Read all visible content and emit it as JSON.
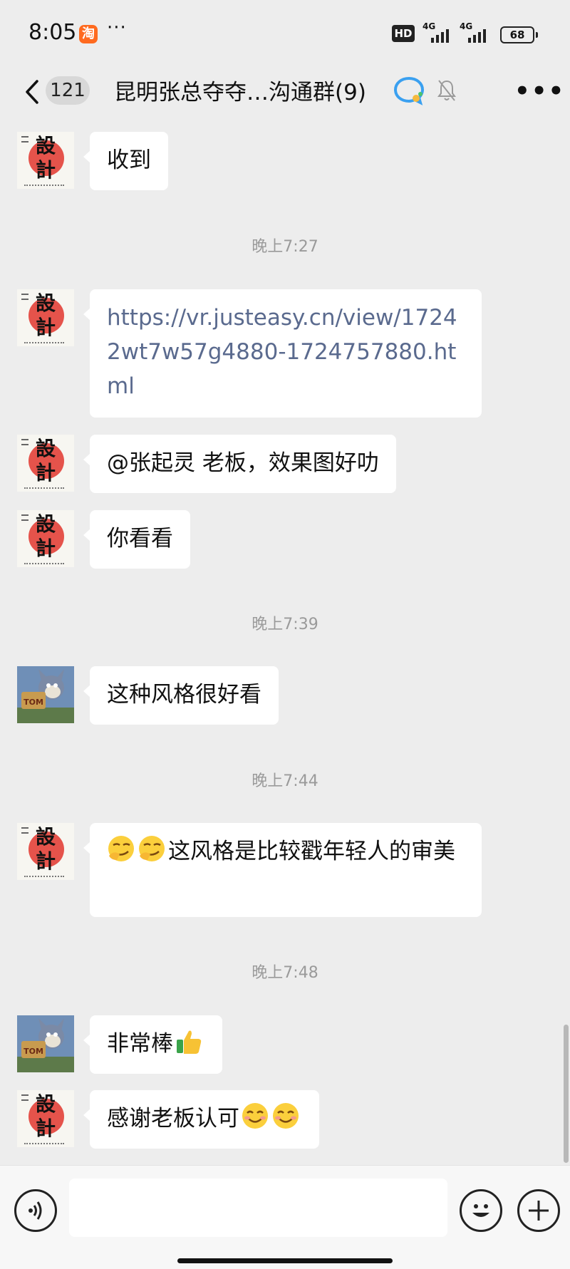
{
  "status_bar": {
    "time": "8:05",
    "app_badge": "淘",
    "more_notifications": "···",
    "hd_label": "HD",
    "network1": "4G",
    "network2": "4G",
    "battery": "68"
  },
  "header": {
    "unread_count": "121",
    "title": "昆明张总夺夺…沟通群(9)",
    "icons": [
      "back-icon",
      "ai-chat-icon",
      "mute-icon",
      "more-icon"
    ]
  },
  "messages": [
    {
      "type": "text",
      "sender": "design",
      "text": "收到"
    },
    {
      "type": "time",
      "text": "晚上7:27"
    },
    {
      "type": "link",
      "sender": "design",
      "text": "https://vr.justeasy.cn/view/17242wt7w57g4880-1724757880.html"
    },
    {
      "type": "text",
      "sender": "design",
      "text": "@张起灵 老板，效果图好叻"
    },
    {
      "type": "text",
      "sender": "design",
      "text": "你看看"
    },
    {
      "type": "time",
      "text": "晚上7:39"
    },
    {
      "type": "text",
      "sender": "tom",
      "text": "这种风格很好看"
    },
    {
      "type": "time",
      "text": "晚上7:44"
    },
    {
      "type": "text",
      "sender": "design",
      "text": "这风格是比较戳年轻人的审美",
      "emoji_prefix": [
        "smirk-emoji",
        "smirk-emoji"
      ]
    },
    {
      "type": "time",
      "text": "晚上7:48"
    },
    {
      "type": "text",
      "sender": "tom",
      "text": "非常棒",
      "emoji_suffix": [
        "thumbs-up-emoji"
      ]
    },
    {
      "type": "text",
      "sender": "design",
      "text": "感谢老板认可",
      "emoji_suffix": [
        "smile-emoji",
        "smile-emoji"
      ]
    }
  ],
  "avatars": {
    "design": {
      "glyph_top": "設",
      "glyph_bottom": "計",
      "accent": "#e5534b"
    },
    "tom": {
      "label": "TOM",
      "accent": "#6f8fb7"
    }
  },
  "input_bar": {
    "placeholder": "",
    "buttons": [
      "voice-button",
      "emoji-button",
      "plus-button"
    ]
  },
  "colors": {
    "background": "#ededed",
    "bubble": "#ffffff",
    "link": "#5a6a8e",
    "timestamp": "#9a9a9a"
  }
}
